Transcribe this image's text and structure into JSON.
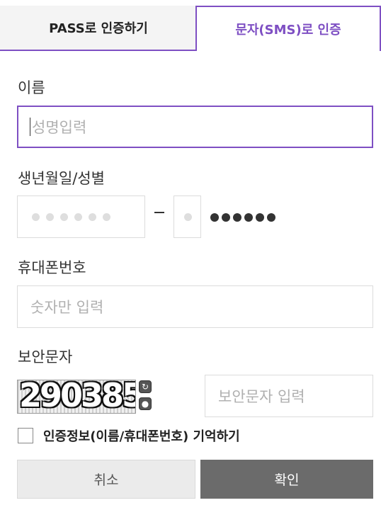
{
  "tabs": {
    "pass_label": "PASS로 인증하기",
    "sms_label": "문자(SMS)로 인증"
  },
  "name": {
    "label": "이름",
    "placeholder": "성명입력"
  },
  "birth": {
    "label": "생년월일/성별",
    "masked_rrn": "●●●●●●"
  },
  "phone": {
    "label": "휴대폰번호",
    "placeholder": "숫자만 입력"
  },
  "captcha": {
    "label": "보안문자",
    "image_text": "290385",
    "input_placeholder": "보안문자 입력",
    "refresh_icon": "refresh-icon",
    "audio_icon": "audio-icon"
  },
  "remember": {
    "label": "인증정보(이름/휴대폰번호) 기억하기"
  },
  "buttons": {
    "cancel": "취소",
    "confirm": "확인"
  },
  "colors": {
    "accent": "#7e4fc3",
    "confirm_bg": "#6b6b6b"
  }
}
